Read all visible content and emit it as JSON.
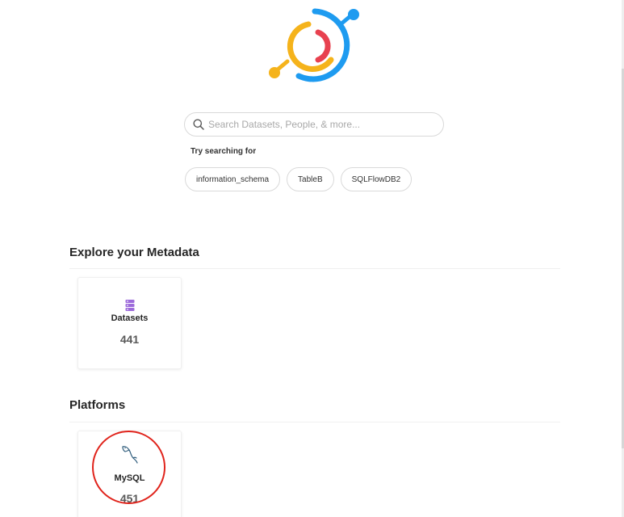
{
  "logo": {
    "name": "datahub-logo-icon",
    "colors": [
      "#1890ff",
      "#f5b31b",
      "#e8414f"
    ]
  },
  "search": {
    "placeholder": "Search Datasets, People, & more...",
    "value": ""
  },
  "suggestions": {
    "label": "Try searching for",
    "items": [
      "information_schema",
      "TableB",
      "SQLFlowDB2"
    ]
  },
  "explore": {
    "title": "Explore your Metadata",
    "cards": [
      {
        "name": "Datasets",
        "count": "441",
        "icon": "dataset-stack-icon",
        "icon_color": "#9d6bdb"
      }
    ]
  },
  "platforms": {
    "title": "Platforms",
    "cards": [
      {
        "name": "MySQL",
        "count": "451",
        "icon": "mysql-dolphin-icon",
        "icon_color": "#2d5b7b"
      }
    ]
  },
  "highlight_color": "#e0231b"
}
